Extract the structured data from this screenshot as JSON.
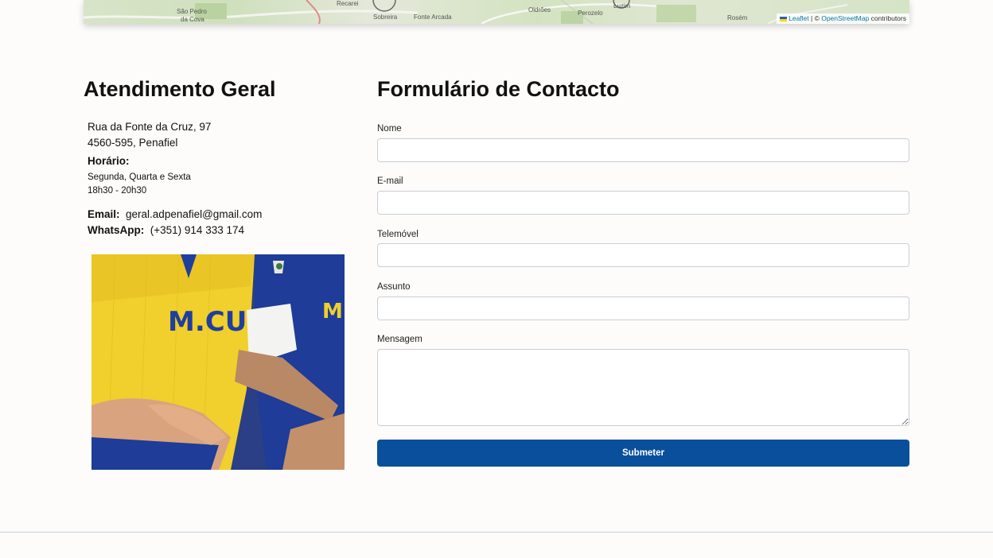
{
  "map": {
    "labels": [
      "São Pedro",
      "da Cova",
      "Recarei",
      "Sobreira",
      "Fonte Arcada",
      "Oldrões",
      "Luzim",
      "Perozelo",
      "Rosém"
    ],
    "attribution": {
      "leaflet": "Leaflet",
      "separator": " | © ",
      "osm": "OpenStreetMap",
      "suffix": " contributors"
    }
  },
  "left": {
    "title": "Atendimento Geral",
    "address_line1": "Rua da Fonte da Cruz, 97",
    "address_line2": "4560-595, Penafiel",
    "hours_title": "Horário:",
    "hours_days": "Segunda, Quarta e Sexta",
    "hours_time": "18h30 - 20h30",
    "email_label": "Email:",
    "email_value": "geral.adpenafiel@gmail.com",
    "whatsapp_label": "WhatsApp:",
    "whatsapp_value": "(+351) 914 333 174"
  },
  "form": {
    "title": "Formulário de Contacto",
    "name_label": "Nome",
    "name_value": "",
    "email_label": "E-mail",
    "email_value": "",
    "phone_label": "Telemóvel",
    "phone_value": "",
    "subject_label": "Assunto",
    "subject_value": "",
    "message_label": "Mensagem",
    "message_value": "",
    "submit_label": "Submeter"
  },
  "colors": {
    "accent": "#0a4f9b",
    "shirt_yellow": "#f2d22e",
    "shirt_blue": "#1f3f9c"
  }
}
